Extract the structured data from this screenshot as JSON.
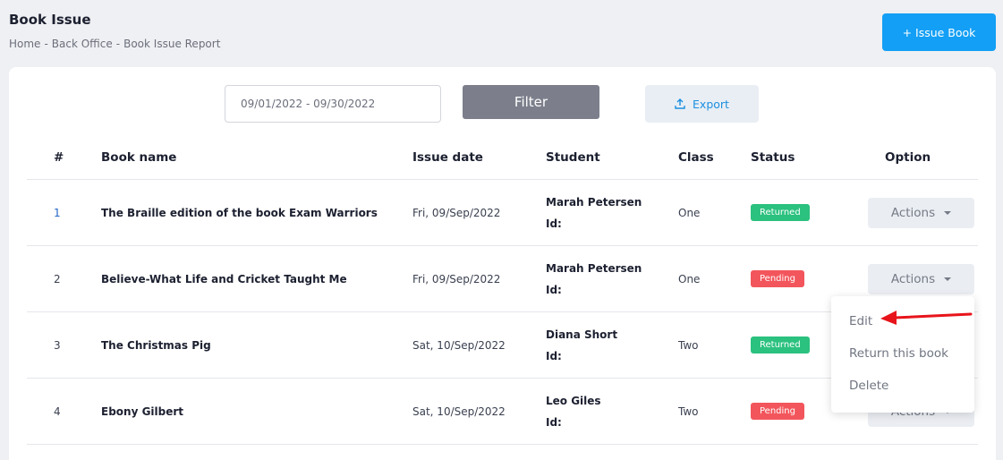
{
  "header": {
    "title": "Book Issue",
    "breadcrumb": [
      "Home",
      "Back Office",
      "Book Issue Report"
    ],
    "breadcrumb_sep": "-",
    "issue_button": "+ Issue Book"
  },
  "toolbar": {
    "date_range": "09/01/2022 - 09/30/2022",
    "filter_label": "Filter",
    "export_label": "Export"
  },
  "table": {
    "columns": [
      "#",
      "Book name",
      "Issue date",
      "Student",
      "Class",
      "Status",
      "Option"
    ],
    "id_label": "Id:",
    "actions_label": "Actions",
    "rows": [
      {
        "num": "1",
        "book": "The Braille edition of the book Exam Warriors",
        "date": "Fri, 09/Sep/2022",
        "student": "Marah Petersen",
        "class": "One",
        "status": "Returned"
      },
      {
        "num": "2",
        "book": "Believe-What Life and Cricket Taught Me",
        "date": "Fri, 09/Sep/2022",
        "student": "Marah Petersen",
        "class": "One",
        "status": "Pending"
      },
      {
        "num": "3",
        "book": "The Christmas Pig",
        "date": "Sat, 10/Sep/2022",
        "student": "Diana Short",
        "class": "Two",
        "status": "Returned"
      },
      {
        "num": "4",
        "book": "Ebony Gilbert",
        "date": "Sat, 10/Sep/2022",
        "student": "Leo Giles",
        "class": "Two",
        "status": "Pending"
      }
    ]
  },
  "dropdown": {
    "items": [
      "Edit",
      "Return this book",
      "Delete"
    ]
  },
  "colors": {
    "primary": "#139ff5",
    "returned": "#2bc17f",
    "pending": "#f2565c",
    "annotation_arrow": "#e8141b"
  }
}
